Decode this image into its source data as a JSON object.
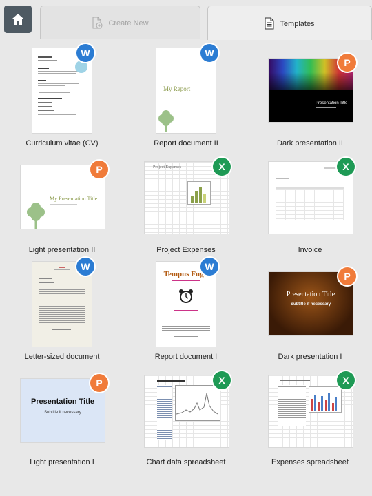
{
  "header": {
    "home_icon": "home-icon",
    "tabs": [
      {
        "label": "Create New",
        "icon": "new-document-icon",
        "active": false
      },
      {
        "label": "Templates",
        "icon": "document-icon",
        "active": true
      }
    ]
  },
  "badge_letters": {
    "word": "W",
    "powerpoint": "P",
    "excel": "X"
  },
  "colors": {
    "word": "#2b7cd3",
    "powerpoint": "#f07b3a",
    "excel": "#1e9a55",
    "home_button": "#4e5a63"
  },
  "templates": [
    {
      "title": "Curriculum vitae (CV)",
      "type": "word"
    },
    {
      "title": "Report document II",
      "type": "word",
      "preview_text": "My Report"
    },
    {
      "title": "Dark presentation II",
      "type": "powerpoint",
      "preview_text": "Presentation Title"
    },
    {
      "title": "Light presentation II",
      "type": "powerpoint",
      "preview_text": "My Presentation Title"
    },
    {
      "title": "Project Expenses",
      "type": "excel",
      "preview_text": "Project Expenses"
    },
    {
      "title": "Invoice",
      "type": "excel"
    },
    {
      "title": "Letter-sized document",
      "type": "word"
    },
    {
      "title": "Report document I",
      "type": "word",
      "preview_text": "Tempus Fugit"
    },
    {
      "title": "Dark presentation I",
      "type": "powerpoint",
      "preview_text": "Presentation Title",
      "preview_subtext": "Subtitle if necessary"
    },
    {
      "title": "Light presentation I",
      "type": "powerpoint",
      "preview_text": "Presentation Title",
      "preview_subtext": "Subtitle if necessary"
    },
    {
      "title": "Chart data spreadsheet",
      "type": "excel"
    },
    {
      "title": "Expenses spreadsheet",
      "type": "excel"
    }
  ]
}
